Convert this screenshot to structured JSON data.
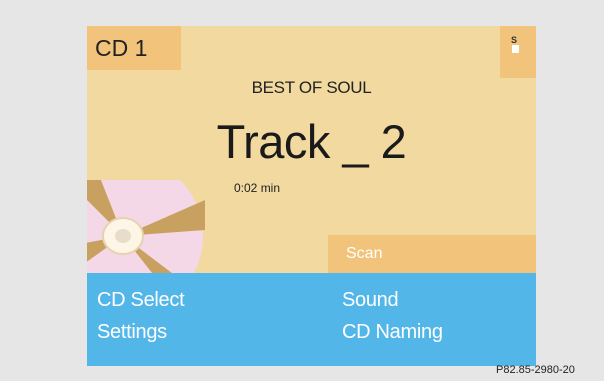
{
  "screen": {
    "source_label": "CD 1",
    "status_glyph": "S",
    "album": "BEST OF SOUL",
    "track": "Track _ 2",
    "elapsed": "0:02 min",
    "scan_label": "Scan",
    "icons": [
      "cd-disc-icon",
      "status-s-icon"
    ]
  },
  "menu": {
    "cd_select": "CD Select",
    "settings": "Settings",
    "sound": "Sound",
    "cd_naming": "CD Naming"
  },
  "caption": "P82.85-2980-20",
  "colors": {
    "screen_bg": "#f1d9a0",
    "accent_tab": "#f2c37a",
    "menu_bar": "#52b6e9",
    "disc_pink": "#f5d8e8",
    "disc_hub": "#c8a160"
  }
}
